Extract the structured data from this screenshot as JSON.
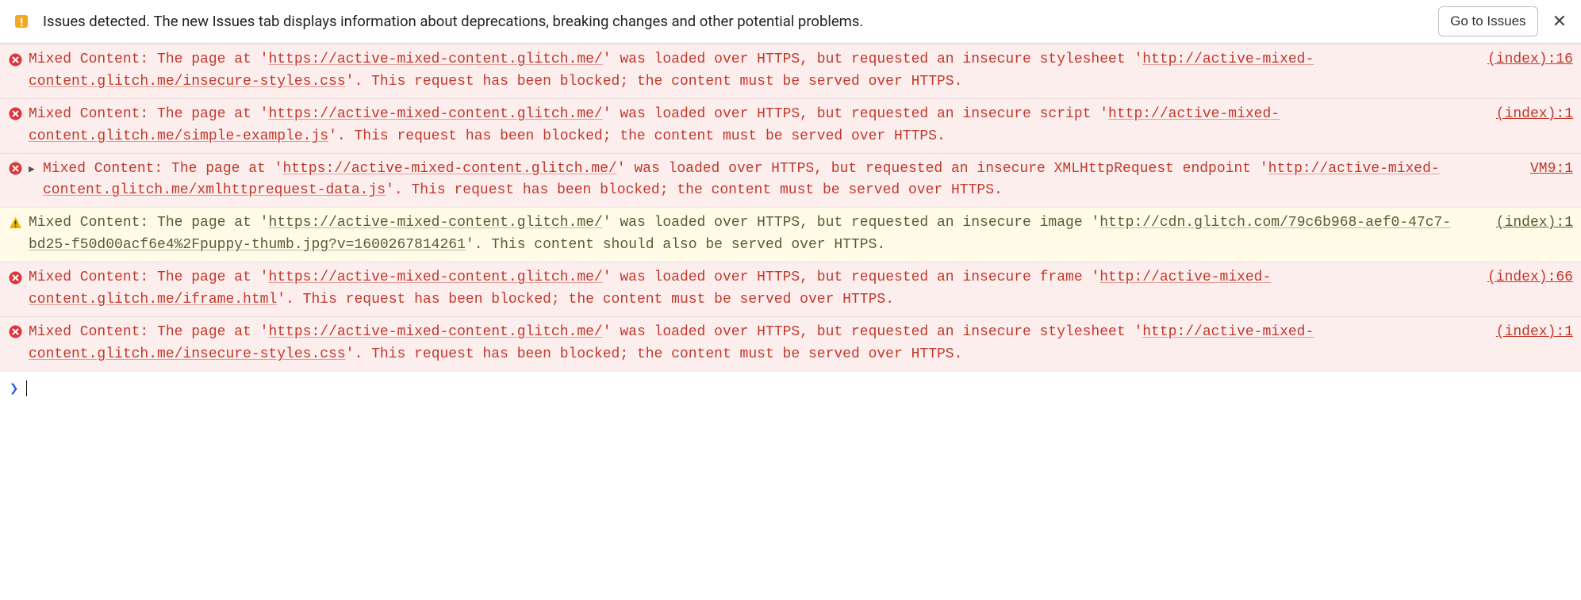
{
  "banner": {
    "text": "Issues detected. The new Issues tab displays information about deprecations, breaking changes and other potential problems.",
    "button": "Go to Issues",
    "close": "✕"
  },
  "console": {
    "messages": [
      {
        "level": "error",
        "expandable": false,
        "parts": [
          {
            "t": "Mixed Content: The page at '"
          },
          {
            "t": "https://active-mixed-content.glitch.me/",
            "u": true
          },
          {
            "t": "' was loaded over HTTPS, but requested an insecure stylesheet '"
          },
          {
            "t": "http://active-mixed-content.glitch.me/insecure-styles.css",
            "u": true
          },
          {
            "t": "'. This request has been blocked; the content must be served over HTTPS."
          }
        ],
        "source": "(index):16"
      },
      {
        "level": "error",
        "expandable": false,
        "parts": [
          {
            "t": "Mixed Content: The page at '"
          },
          {
            "t": "https://active-mixed-content.glitch.me/",
            "u": true
          },
          {
            "t": "' was loaded over HTTPS, but requested an insecure script '"
          },
          {
            "t": "http://active-mixed-content.glitch.me/simple-example.js",
            "u": true
          },
          {
            "t": "'. This request has been blocked; the content must be served over HTTPS."
          }
        ],
        "source": "(index):1"
      },
      {
        "level": "error",
        "expandable": true,
        "parts": [
          {
            "t": "Mixed Content: The page at '"
          },
          {
            "t": "https://active-mixed-content.glitch.me/",
            "u": true
          },
          {
            "t": "' was loaded over HTTPS, but requested an insecure XMLHttpRequest endpoint '"
          },
          {
            "t": "http://active-mixed-content.glitch.me/xmlhttprequest-data.js",
            "u": true
          },
          {
            "t": "'. This request has been blocked; the content must be served over HTTPS."
          }
        ],
        "source": "VM9:1"
      },
      {
        "level": "warning",
        "expandable": false,
        "parts": [
          {
            "t": "Mixed Content: The page at '"
          },
          {
            "t": "https://active-mixed-content.glitch.me/",
            "u": true
          },
          {
            "t": "' was loaded over HTTPS, but requested an insecure image '"
          },
          {
            "t": "http://cdn.glitch.com/79c6b968-aef0-47c7-bd25-f50d00acf6e4%2Fpuppy-thumb.jpg?v=1600267814261",
            "u": true
          },
          {
            "t": "'. This content should also be served over HTTPS."
          }
        ],
        "source": "(index):1"
      },
      {
        "level": "error",
        "expandable": false,
        "parts": [
          {
            "t": "Mixed Content: The page at '"
          },
          {
            "t": "https://active-mixed-content.glitch.me/",
            "u": true
          },
          {
            "t": "' was loaded over HTTPS, but requested an insecure frame '"
          },
          {
            "t": "http://active-mixed-content.glitch.me/iframe.html",
            "u": true
          },
          {
            "t": "'. This request has been blocked; the content must be served over HTTPS."
          }
        ],
        "source": "(index):66"
      },
      {
        "level": "error",
        "expandable": false,
        "parts": [
          {
            "t": "Mixed Content: The page at '"
          },
          {
            "t": "https://active-mixed-content.glitch.me/",
            "u": true
          },
          {
            "t": "' was loaded over HTTPS, but requested an insecure stylesheet '"
          },
          {
            "t": "http://active-mixed-content.glitch.me/insecure-styles.css",
            "u": true
          },
          {
            "t": "'. This request has been blocked; the content must be served over HTTPS."
          }
        ],
        "source": "(index):1"
      }
    ]
  }
}
